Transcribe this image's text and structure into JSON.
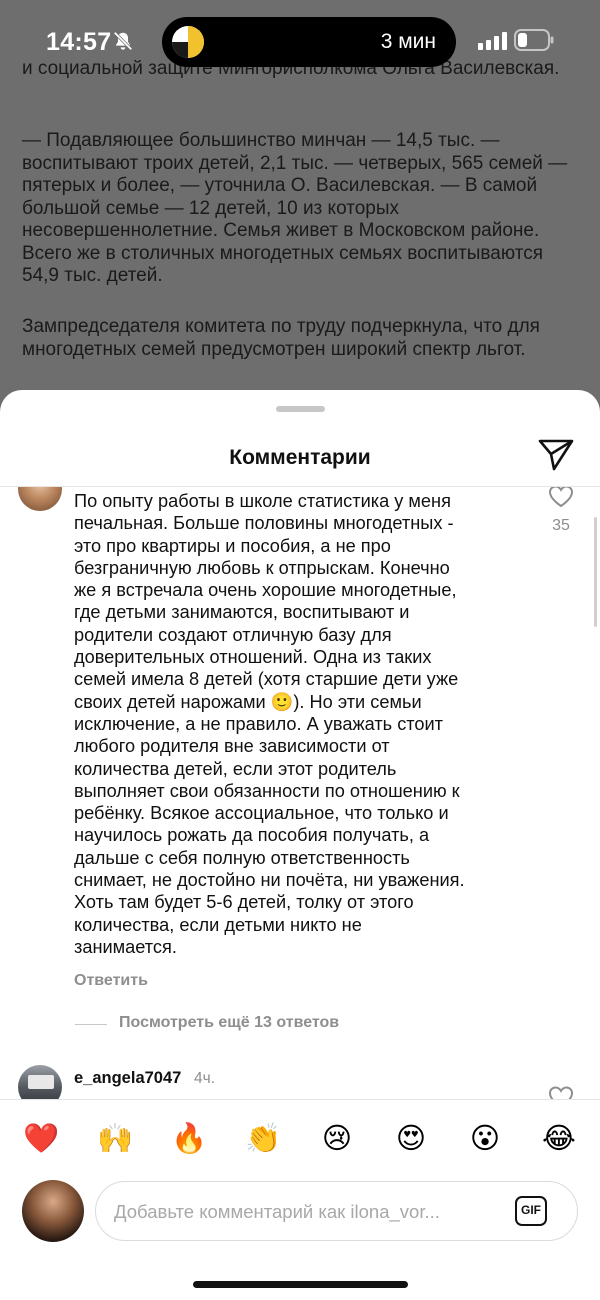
{
  "status_bar": {
    "time": "14:57",
    "island_text": "3 мин"
  },
  "article": {
    "paragraphs": [
      "и социальной защите Мингорисполкома Ольга Василевская.",
      "— Подавляющее большинство минчан — 14,5 тыс. — воспитывают троих детей, 2,1 тыс. — четверых, 565 семей — пятерых и более, — уточнила О. Василевская. — В самой большой семье — 12 детей, 10 из которых несовершеннолетние. Семья живет в Московском районе. Всего же в столичных многодетных семьях воспитываются 54,9 тыс. детей.",
      "Зампредседателя комитета по труду подчеркнула, что для многодетных семей предусмотрен широкий спектр льгот."
    ]
  },
  "sheet": {
    "title": "Комментарии"
  },
  "comment": {
    "text": "По опыту работы в школе статистика у меня\nпечальная.  Больше половины многодетных -\nэто про квартиры и пособия, а не про\nбезграничную любовь к отпрыскам. Конечно\nже я встречала очень хорошие многодетные,\nгде детьми занимаются, воспитывают и\nродители создают отличную базу для\nдоверительных отношений. Одна из таких\nсемей имела 8 детей (хотя старшие дети уже\nсвоих детей нарожами 🙂). Но эти семьи\nисключение, а не правило. А уважать стоит\nлюбого родителя вне зависимости от\nколичества детей,  если этот родитель\nвыполняет свои обязанности по отношению к\nребёнку.  Всякое ассоциальное, что только и\nнаучилось рожать да пособия получать, а\nдальше с себя полную ответственность\nснимает, не достойно ни почёта,  ни уважения.\nХоть там будет 5-6 детей,  толку от этого\nколичества,  если детьми никто не\nзанимается.",
    "likes": "35",
    "reply_label": "Ответить",
    "view_replies_label": "Посмотреть ещё 13 ответов"
  },
  "next_comment": {
    "username": "e_angela7047",
    "time": "4ч."
  },
  "emojis": [
    "❤️",
    "🙌",
    "🔥",
    "👏",
    "😢",
    "😍",
    "😮",
    "😂"
  ],
  "input": {
    "placeholder": "Добавьте комментарий как ilona_vor...",
    "gif_label": "GIF"
  },
  "colors": {
    "like_gray": "#8e8e8e",
    "heart_red": "#ed2133"
  }
}
